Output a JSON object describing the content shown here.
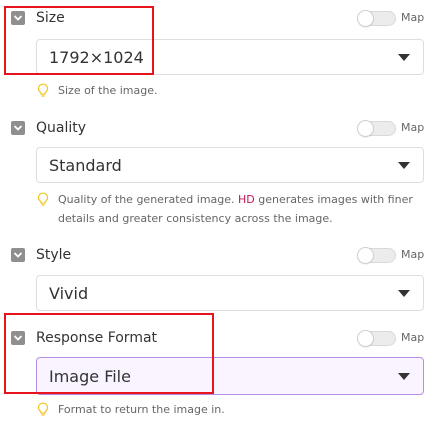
{
  "fields": [
    {
      "label": "Size",
      "map_label": "Map",
      "value": "1792×1024",
      "hint_parts": [
        "Size of the image."
      ]
    },
    {
      "label": "Quality",
      "map_label": "Map",
      "value": "Standard",
      "hint_parts": [
        "Quality of the generated image. ",
        "HD",
        " generates images with finer",
        "details and greater consistency across the image."
      ]
    },
    {
      "label": "Style",
      "map_label": "Map",
      "value": "Vivid"
    },
    {
      "label": "Response Format",
      "map_label": "Map",
      "value": "Image File",
      "hint_parts": [
        "Format to return the image in."
      ]
    }
  ],
  "colors": {
    "highlight_box": "#e8141c",
    "hd_text": "#c2185b",
    "focus_border": "#b58ee6",
    "hint_bulb": "#f0c419"
  }
}
